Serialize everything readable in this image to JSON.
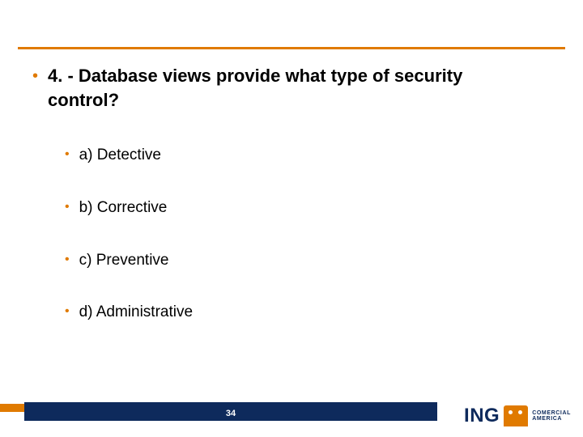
{
  "slide": {
    "question": "4. - Database views provide what type of security control?",
    "options": [
      "a) Detective",
      "b)  Corrective",
      "c) Preventive",
      "d) Administrative"
    ],
    "page_number": "34",
    "logo": {
      "brand": "ING",
      "sub1": "COMERCIAL",
      "sub2": "AMERICA"
    }
  }
}
